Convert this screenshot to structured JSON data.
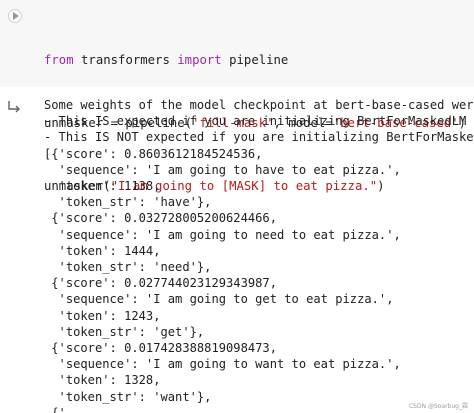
{
  "code_cell": {
    "lines": [
      [
        "from",
        " transformers ",
        "import",
        " pipeline"
      ],
      [
        "unmasker = pipeline(",
        "'fill-mask'",
        ", model=",
        "'bert-base-cased'",
        ")"
      ],
      [
        "unmasker(",
        "\"I am going to [MASK] to eat pizza.\"",
        ")"
      ]
    ]
  },
  "output": {
    "lines": [
      "Some weights of the model checkpoint at bert-base-cased were",
      "- This IS expected if you are initializing BertForMaskedLM f",
      "- This IS NOT expected if you are initializing BertForMasked",
      "[{'score': 0.8603612184524536,",
      "  'sequence': 'I am going to have to eat pizza.',",
      "  'token': 1138,",
      "  'token_str': 'have'},",
      " {'score': 0.032728005200624466,",
      "  'sequence': 'I am going to need to eat pizza.',",
      "  'token': 1444,",
      "  'token_str': 'need'},",
      " {'score': 0.027744023129343987,",
      "  'sequence': 'I am going to get to eat pizza.',",
      "  'token': 1243,",
      "  'token_str': 'get'},",
      " {'score': 0.017428388819098473,",
      "  'sequence': 'I am going to want to eat pizza.',",
      "  'token': 1328,",
      "  'token_str': 'want'},",
      " {'"
    ]
  },
  "watermark": "CSDN @Soarbug_霖",
  "colors": {
    "keyword": "#9c27b0",
    "string": "#b71c1c",
    "cell_bg": "#f7f7f7"
  },
  "icons": {
    "run": "play-icon",
    "output": "output-arrow-icon"
  }
}
